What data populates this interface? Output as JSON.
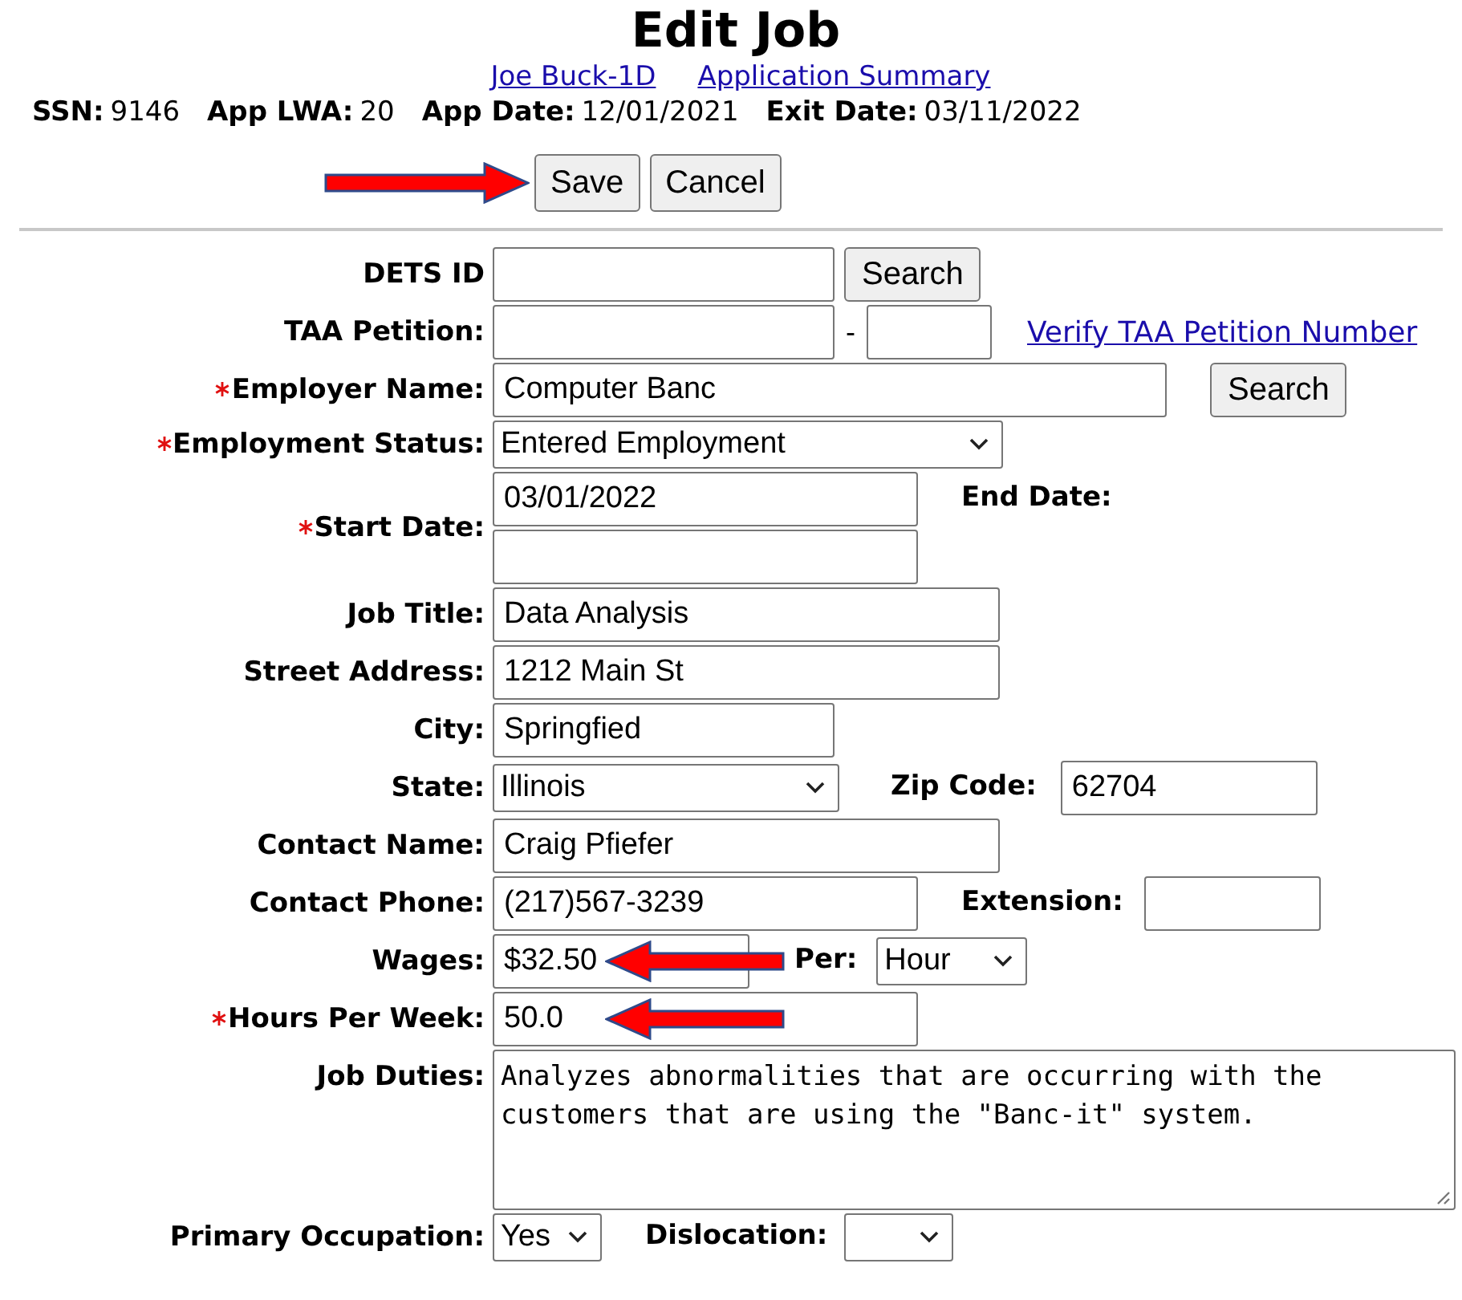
{
  "title": "Edit Job",
  "links": [
    "Joe Buck-1D",
    "Application Summary"
  ],
  "info": [
    {
      "label": "SSN:",
      "value": "9146"
    },
    {
      "label": "App LWA:",
      "value": "20"
    },
    {
      "label": "App Date:",
      "value": "12/01/2021"
    },
    {
      "label": "Exit Date:",
      "value": "03/11/2022"
    }
  ],
  "buttons": [
    {
      "label": "Save",
      "arrow": true
    },
    {
      "label": "Cancel",
      "arrow": false
    }
  ],
  "rows": [
    {
      "label": "DETS ID",
      "required": false,
      "controls": [
        {
          "kind": "input"
        },
        {
          "kind": "button",
          "label": "Search"
        }
      ]
    },
    {
      "label": "TAA Petition:",
      "required": false,
      "controls": [
        {
          "kind": "input"
        },
        {
          "kind": "text",
          "text": "-"
        },
        {
          "kind": "input"
        },
        {
          "kind": "link",
          "text": "Verify TAA Petition Number"
        }
      ]
    },
    {
      "label": "Employer Name:",
      "required": true,
      "controls": [
        {
          "kind": "input",
          "value": "Computer Banc"
        },
        {
          "kind": "button",
          "label": "Search"
        }
      ]
    },
    {
      "label": "Employment Status:",
      "required": true,
      "controls": [
        {
          "kind": "select",
          "value": "Entered Employment"
        }
      ]
    },
    {
      "label": "Start Date:",
      "required": true,
      "controls": [
        {
          "kind": "stack",
          "fields": [
            {
              "kind": "input",
              "value": "03/01/2022"
            },
            {
              "kind": "input"
            }
          ]
        },
        {
          "kind": "label",
          "text": "End Date:"
        }
      ]
    },
    {
      "label": "Job Title:",
      "required": false,
      "controls": [
        {
          "kind": "input",
          "value": "Data Analysis"
        }
      ]
    },
    {
      "label": "Street Address:",
      "required": false,
      "controls": [
        {
          "kind": "input",
          "value": "1212 Main St"
        }
      ]
    },
    {
      "label": "City:",
      "required": false,
      "controls": [
        {
          "kind": "input",
          "value": "Springfied"
        }
      ]
    },
    {
      "label": "State:",
      "required": false,
      "controls": [
        {
          "kind": "select",
          "value": "Illinois"
        },
        {
          "kind": "label",
          "text": "Zip Code:"
        },
        {
          "kind": "input",
          "value": "62704"
        }
      ]
    },
    {
      "label": "Contact Name:",
      "required": false,
      "controls": [
        {
          "kind": "input",
          "value": "Craig Pfiefer"
        }
      ]
    },
    {
      "label": "Contact Phone:",
      "required": false,
      "controls": [
        {
          "kind": "input",
          "value": "(217)567-3239"
        },
        {
          "kind": "label",
          "text": "Extension:"
        },
        {
          "kind": "input"
        }
      ]
    },
    {
      "label": "Wages:",
      "required": false,
      "controls": [
        {
          "kind": "input",
          "value": "$32.50",
          "arrow": true
        },
        {
          "kind": "label",
          "text": "Per:"
        },
        {
          "kind": "select",
          "value": "Hour"
        }
      ]
    },
    {
      "label": "Hours Per Week:",
      "required": true,
      "controls": [
        {
          "kind": "input",
          "value": "50.0",
          "arrow": true
        }
      ]
    },
    {
      "label": "Job Duties:",
      "required": false,
      "controls": [
        {
          "kind": "textarea",
          "value": "Analyzes abnormalities that are occurring with the customers that are using the \"Banc-it\" system."
        }
      ]
    },
    {
      "label": "Primary Occupation:",
      "required": false,
      "controls": [
        {
          "kind": "select",
          "value": "Yes"
        },
        {
          "kind": "label",
          "text": "Dislocation:"
        },
        {
          "kind": "select"
        }
      ]
    }
  ]
}
